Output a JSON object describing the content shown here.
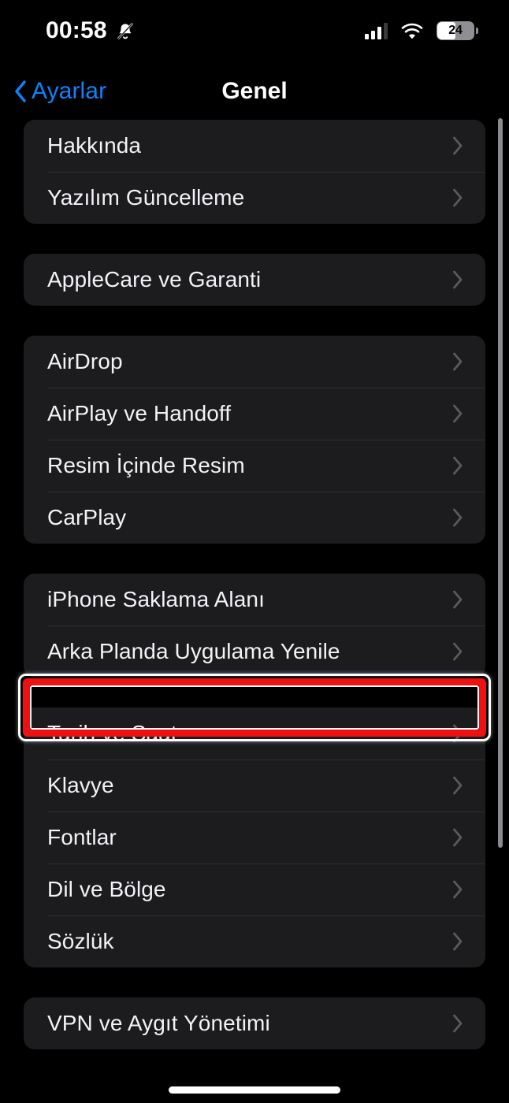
{
  "status_bar": {
    "time": "00:58",
    "bell_icon": "bell-slash-icon",
    "signal_icon": "cellular-signal-icon",
    "wifi_icon": "wifi-icon",
    "battery_percent": "24",
    "battery_fill_ratio": 0.5
  },
  "nav": {
    "back_label": "Ayarlar",
    "back_icon": "chevron-left-icon",
    "title": "Genel"
  },
  "colors": {
    "accent_blue": "#0A84FF",
    "card_background": "#1C1C1E",
    "page_background": "#000000",
    "label_primary": "#F2F2F7",
    "chevron_gray": "#5A5A5E",
    "highlight_red": "#EE1111",
    "highlight_white": "#FFFFFF",
    "scrollbar_gray": "#8A8A8E"
  },
  "groups": [
    {
      "rows": [
        {
          "label": "Hakkında",
          "chevron": "chevron-right-icon",
          "highlighted": false
        },
        {
          "label": "Yazılım Güncelleme",
          "chevron": "chevron-right-icon",
          "highlighted": false
        }
      ]
    },
    {
      "rows": [
        {
          "label": "AppleCare ve Garanti",
          "chevron": "chevron-right-icon",
          "highlighted": false
        }
      ]
    },
    {
      "rows": [
        {
          "label": "AirDrop",
          "chevron": "chevron-right-icon",
          "highlighted": false
        },
        {
          "label": "AirPlay ve Handoff",
          "chevron": "chevron-right-icon",
          "highlighted": false
        },
        {
          "label": "Resim İçinde Resim",
          "chevron": "chevron-right-icon",
          "highlighted": false
        },
        {
          "label": "CarPlay",
          "chevron": "chevron-right-icon",
          "highlighted": false
        }
      ]
    },
    {
      "rows": [
        {
          "label": "iPhone Saklama Alanı",
          "chevron": "chevron-right-icon",
          "highlighted": false
        },
        {
          "label": "Arka Planda Uygulama Yenile",
          "chevron": "chevron-right-icon",
          "highlighted": true
        }
      ]
    },
    {
      "rows": [
        {
          "label": "Tarih ve Saat",
          "chevron": "chevron-right-icon",
          "highlighted": false
        },
        {
          "label": "Klavye",
          "chevron": "chevron-right-icon",
          "highlighted": false
        },
        {
          "label": "Fontlar",
          "chevron": "chevron-right-icon",
          "highlighted": false
        },
        {
          "label": "Dil ve Bölge",
          "chevron": "chevron-right-icon",
          "highlighted": false
        },
        {
          "label": "Sözlük",
          "chevron": "chevron-right-icon",
          "highlighted": false
        }
      ]
    },
    {
      "rows": [
        {
          "label": "VPN ve Aygıt Yönetimi",
          "chevron": "chevron-right-icon",
          "highlighted": false
        }
      ]
    }
  ],
  "home_indicator": "home-indicator"
}
